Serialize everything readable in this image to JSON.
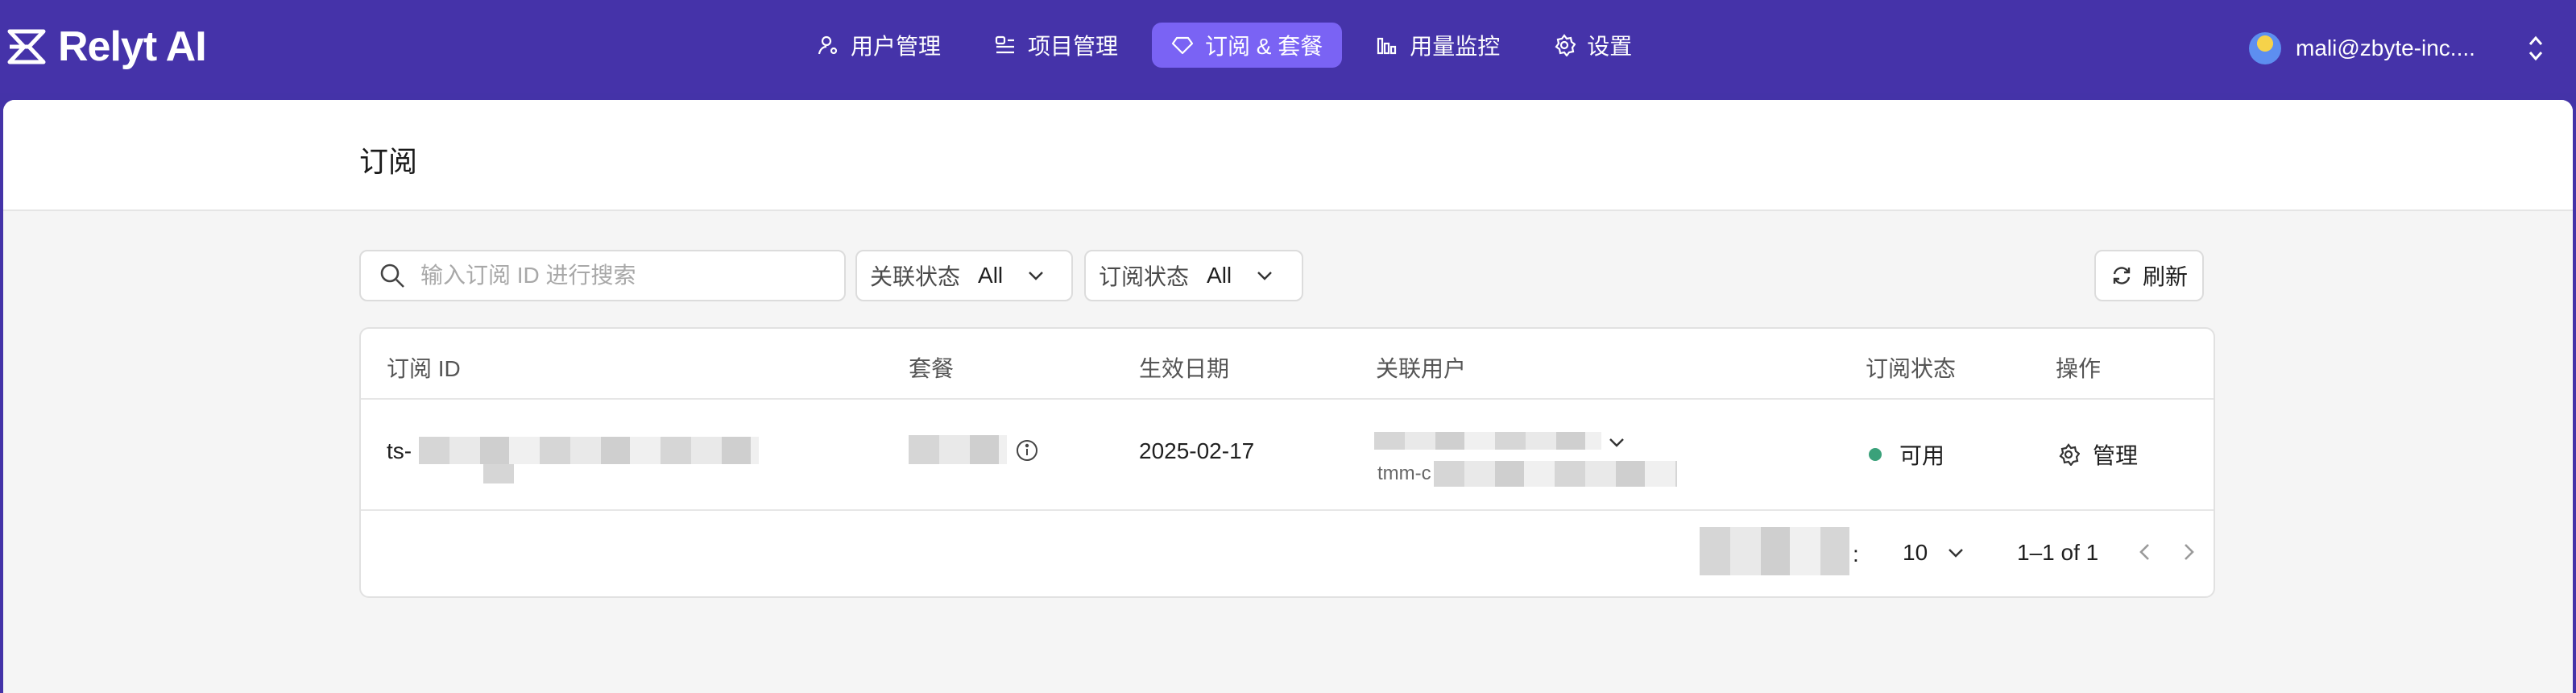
{
  "app": {
    "name": "Relyt AI"
  },
  "nav": {
    "items": [
      {
        "label": "用户管理",
        "icon": "user-manage-icon"
      },
      {
        "label": "项目管理",
        "icon": "project-icon"
      },
      {
        "label": "订阅 & 套餐",
        "icon": "diamond-icon",
        "active": true
      },
      {
        "label": "用量监控",
        "icon": "bar-chart-icon"
      },
      {
        "label": "设置",
        "icon": "gear-icon"
      }
    ]
  },
  "account": {
    "email": "mali@zbyte-inc...."
  },
  "page": {
    "title": "订阅"
  },
  "filters": {
    "search_placeholder": "输入订阅 ID 进行搜索",
    "link_status": {
      "label": "关联状态",
      "value": "All"
    },
    "sub_status": {
      "label": "订阅状态",
      "value": "All"
    },
    "refresh_label": "刷新"
  },
  "table": {
    "columns": [
      "订阅 ID",
      "套餐",
      "生效日期",
      "关联用户",
      "订阅状态",
      "操作"
    ],
    "rows": [
      {
        "id_prefix": "ts-",
        "effective_date": "2025-02-17",
        "user_sub_prefix": "tmm-c",
        "status": "可用",
        "action": "管理"
      }
    ]
  },
  "pagination": {
    "page_size_suffix": ":",
    "page_size": "10",
    "range": "1–1 of 1"
  },
  "colors": {
    "nav_bg": "#4533a9",
    "active_tab": "#7a63f4",
    "status_ok": "#3aa17a"
  }
}
